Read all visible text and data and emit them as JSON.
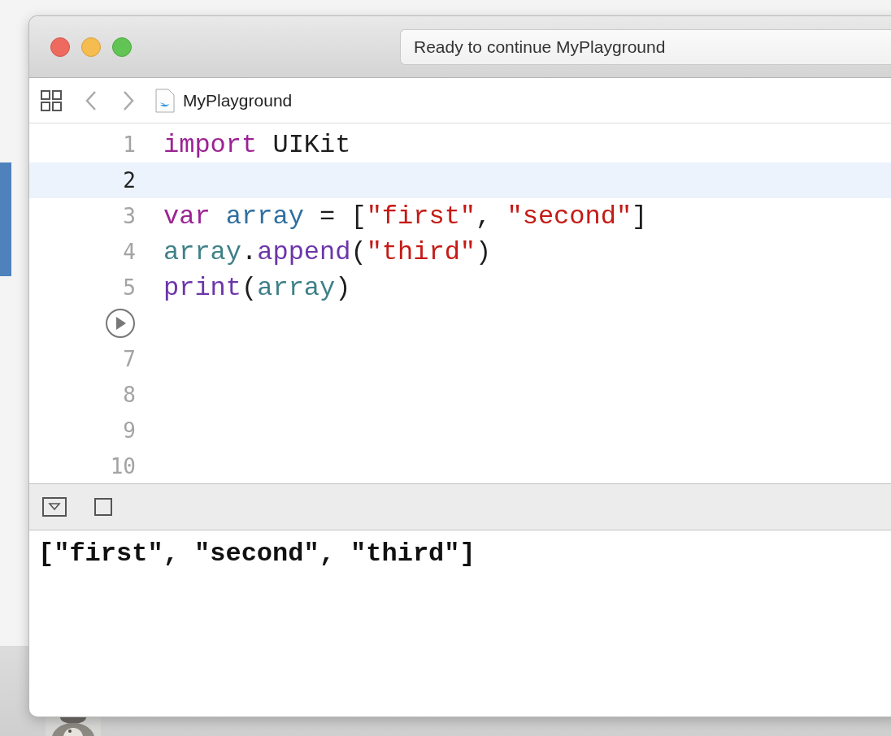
{
  "window": {
    "status": "Ready to continue MyPlayground"
  },
  "toolbar": {
    "file_name": "MyPlayground"
  },
  "editor": {
    "lines": [
      {
        "kind": "numbered",
        "number": "1",
        "selected": false,
        "tokens": [
          {
            "kind": "keyword",
            "text": "import"
          },
          {
            "kind": "plain",
            "text": " UIKit"
          }
        ]
      },
      {
        "kind": "numbered",
        "number": "2",
        "selected": true
      },
      {
        "kind": "numbered",
        "number": "3",
        "selected": false,
        "tokens": [
          {
            "kind": "keyword",
            "text": "var "
          },
          {
            "kind": "declaration",
            "text": "array"
          },
          {
            "kind": "plain",
            "text": " = ["
          },
          {
            "kind": "string",
            "text": "\"first\""
          },
          {
            "kind": "plain",
            "text": ", "
          },
          {
            "kind": "string",
            "text": "\"second\""
          },
          {
            "kind": "plain",
            "text": "]"
          }
        ]
      },
      {
        "kind": "numbered",
        "number": "4",
        "selected": false,
        "tokens": [
          {
            "kind": "identifier",
            "text": "array"
          },
          {
            "kind": "plain",
            "text": "."
          },
          {
            "kind": "method",
            "text": "append"
          },
          {
            "kind": "plain",
            "text": "("
          },
          {
            "kind": "string",
            "text": "\"third\""
          },
          {
            "kind": "plain",
            "text": ")"
          }
        ]
      },
      {
        "kind": "numbered",
        "number": "5",
        "selected": false,
        "tokens": [
          {
            "kind": "method",
            "text": "print"
          },
          {
            "kind": "plain",
            "text": "("
          },
          {
            "kind": "identifier",
            "text": "array"
          },
          {
            "kind": "plain",
            "text": ")"
          }
        ]
      },
      {
        "kind": "run",
        "selected": false
      },
      {
        "kind": "numbered",
        "number": "7",
        "selected": false
      },
      {
        "kind": "numbered",
        "number": "8",
        "selected": false
      },
      {
        "kind": "numbered",
        "number": "9",
        "selected": false
      },
      {
        "kind": "numbered",
        "number": "10",
        "selected": false
      }
    ]
  },
  "console": {
    "output": "[\"first\", \"second\", \"third\"]"
  }
}
